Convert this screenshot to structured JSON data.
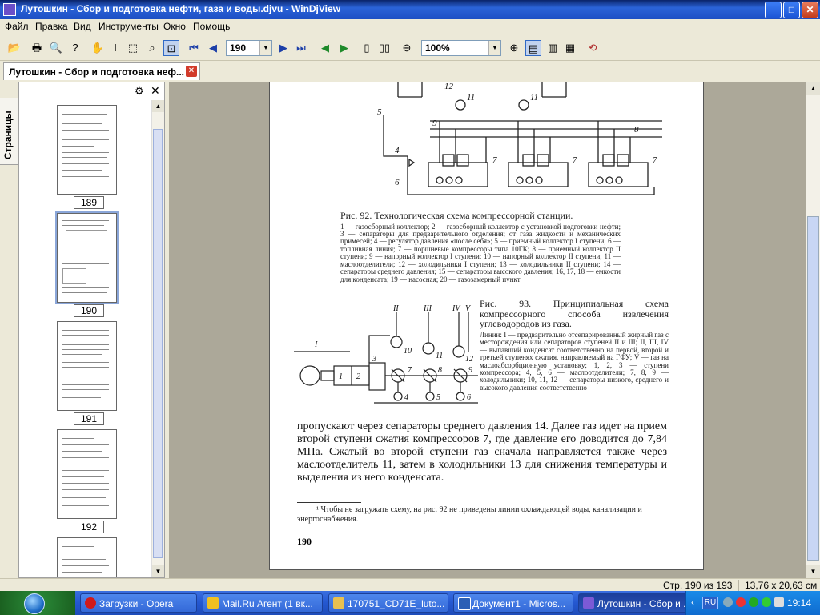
{
  "window": {
    "title": "Лутошкин - Сбор и подготовка нефти, газа и воды.djvu - WinDjView",
    "buttons": {
      "minimize": "_",
      "maximize": "□",
      "close": "✕"
    }
  },
  "menu": [
    "Файл",
    "Правка",
    "Вид",
    "Инструменты",
    "Окно",
    "Помощь"
  ],
  "toolbar": {
    "page_value": "190",
    "zoom_value": "100%",
    "icons": [
      "open-icon",
      "print-icon",
      "find-icon",
      "help-icon",
      "hand-icon",
      "text-select-icon",
      "rect-select-icon",
      "zoom-icon",
      "zoom-rect-icon",
      "first-page-icon",
      "prev-page-icon",
      "next-page-icon",
      "last-page-icon",
      "back-icon",
      "forward-icon",
      "single-page-icon",
      "two-pages-icon",
      "zoom-out-icon",
      "zoom-in-icon",
      "continuous-icon",
      "facing-icon",
      "fit-icon",
      "rotate-icon"
    ]
  },
  "tab": {
    "label": "Лутошкин - Сбор и подготовка неф...",
    "close": "✕"
  },
  "sidebar": {
    "tab_label": "Страницы",
    "pages": [
      "189",
      "190",
      "191",
      "192"
    ]
  },
  "document": {
    "fig92_caption": "Рис. 92. Технологическая схема компрессорной станции.",
    "fig92_legend": "1 — газосборный коллектор; 2 — газосборный коллектор с установкой подготовки нефти; 3 — сепараторы для предварительного отделения; от газа жидкости и механических примесей; 4 — регулятор давления «после себя»; 5 — приемный коллектор I ступени; 6 — топливная линия; 7 — поршневые компрессоры типа 10ГК; 8 — приемный коллектор II ступени; 9 — напорный коллектор I ступени; 10 — напорный коллектор II ступени; 11 — маслоотделители; 12 — холодильники I ступени; 13 — холодильники II ступени; 14 — сепараторы среднего давления; 15 — сепараторы высокого давления; 16, 17, 18 — емкости для конденсата; 19 — насосная; 20 — газозамерный пункт",
    "fig93_caption": "Рис. 93. Принципиальная схема компрессорного способа извлечения углеводородов из газа.",
    "fig93_legend": "Линии: I — предварительно отсепарированный жирный газ с месторождения или сепараторов ступеней II и III; II, III, IV — выпавший конденсат соответственно на первой, второй и третьей ступенях сжатия, направляемый на ГФУ; V — газ на маслоабсорбционную установку; 1, 2, 3 — ступени компрессора; 4, 5, 6 — маслоотделители; 7, 8, 9 — холодильники; 10, 11, 12 — сепараторы низкого, среднего и высокого давления соответственно",
    "body_text": "пропускают через сепараторы среднего давления 14. Далее газ идет на прием второй ступени сжатия компрессоров 7, где давление его доводится до 7,84 МПа. Сжатый во второй ступени газ сначала направляется также через маслоотделитель 11, затем в холодильники 13 для снижения температуры и выделения из него конденсата.",
    "footnote": "¹ Чтобы не загружать схему, на рис. 92 не приведены линии охлаждающей воды, канализации и энергоснабжения.",
    "page_number": "190",
    "diagram_labels": {
      "fig92": [
        "5",
        "4",
        "6",
        "9",
        "8",
        "7",
        "7",
        "7",
        "12",
        "11",
        "11"
      ],
      "fig93": [
        "I",
        "II",
        "III",
        "IV",
        "V",
        "1",
        "2",
        "3",
        "10",
        "11",
        "12",
        "7",
        "8",
        "9",
        "4",
        "5",
        "6"
      ]
    }
  },
  "status": {
    "page": "Стр. 190 из 193",
    "size": "13,76 x 20,63 см"
  },
  "taskbar": {
    "items": [
      "Загрузки - Opera",
      "Mail.Ru Агент (1 вк...",
      "170751_CD71E_luto...",
      "Документ1 - Micros...",
      "Лутошкин - Сбор и ..."
    ],
    "lang": "RU",
    "time": "19:14"
  }
}
